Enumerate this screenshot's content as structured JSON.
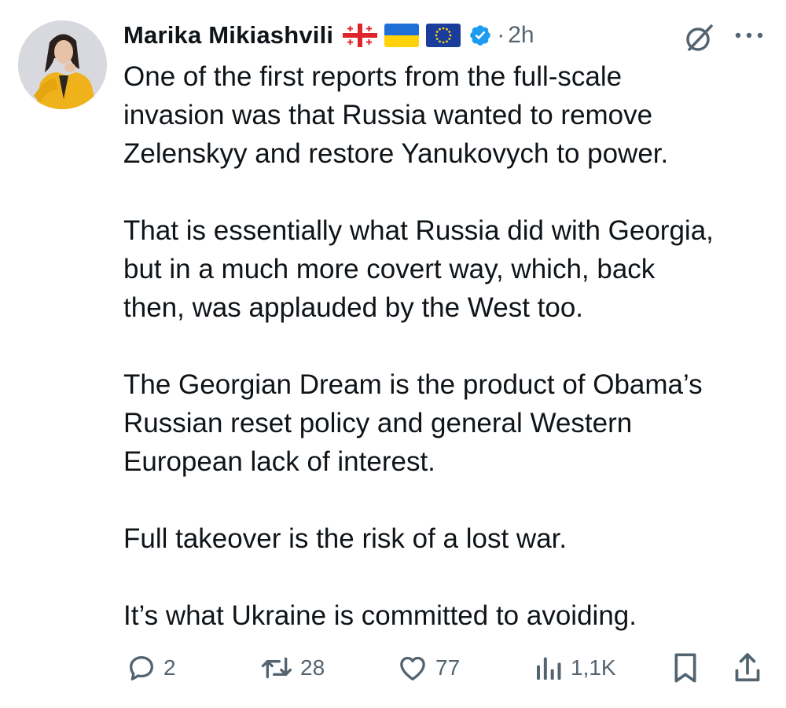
{
  "author": {
    "display_name": "Marika Mikiashvili",
    "flags": [
      "georgia-flag",
      "ukraine-flag",
      "eu-flag"
    ],
    "verified": true,
    "separator": "·",
    "time": "2h"
  },
  "tweet": {
    "paragraphs": [
      [
        "One of the first reports from the full-scale",
        "invasion was that Russia wanted to remove",
        "Zelenskyy and restore Yanukovych to power."
      ],
      [
        "That is essentially what Russia did with Georgia,",
        "but in a much more covert way, which, back",
        "then, was applauded by the West too."
      ],
      [
        "The Georgian Dream is the product of Obama’s",
        "Russian reset policy and general Western",
        "European lack of interest."
      ],
      [
        "Full takeover is the risk of a lost war."
      ],
      [
        "It’s what Ukraine is committed to avoiding."
      ]
    ]
  },
  "actions": {
    "reply_count": "2",
    "repost_count": "28",
    "like_count": "77",
    "views_count": "1,1K"
  },
  "icons": {
    "reply": "reply-icon",
    "repost": "repost-icon",
    "like": "heart-icon",
    "views": "views-icon",
    "bookmark": "bookmark-icon",
    "share": "share-icon",
    "grok": "grok-icon",
    "more": "more-icon"
  },
  "colors": {
    "text": "#0f1419",
    "secondary": "#536471",
    "verified": "#1d9bf0"
  }
}
